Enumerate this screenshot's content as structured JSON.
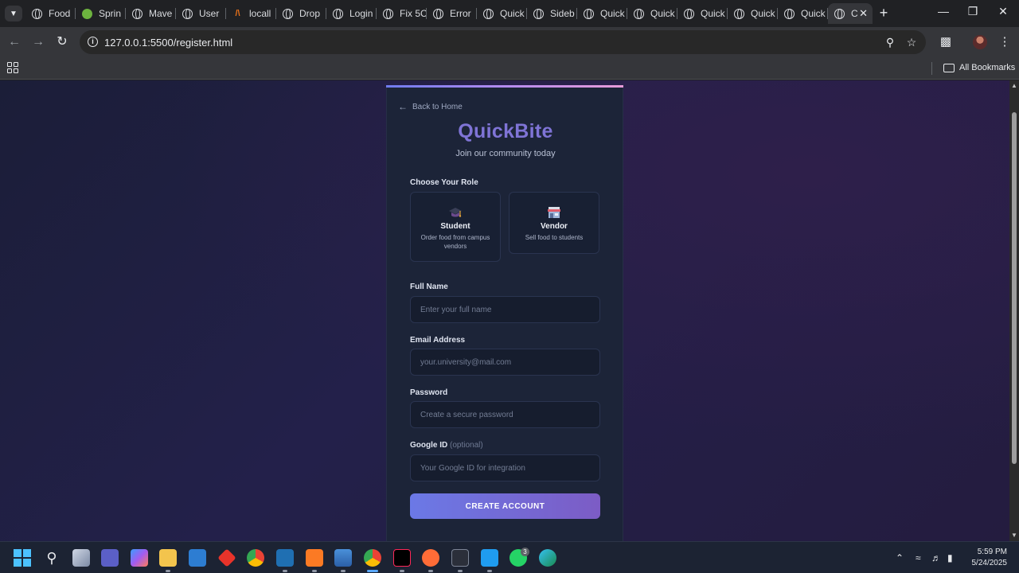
{
  "browser": {
    "tabs": [
      {
        "title": "Food",
        "icon": "globe"
      },
      {
        "title": "Sprin",
        "icon": "spring-leaf"
      },
      {
        "title": "Mave",
        "icon": "globe"
      },
      {
        "title": "User",
        "icon": "globe"
      },
      {
        "title": "locall",
        "icon": "maven"
      },
      {
        "title": "Drop",
        "icon": "globe"
      },
      {
        "title": "Login",
        "icon": "globe"
      },
      {
        "title": "Fix 5C",
        "icon": "globe"
      },
      {
        "title": "Error",
        "icon": "globe-outline"
      },
      {
        "title": "Quick",
        "icon": "globe-outline"
      },
      {
        "title": "Sideb",
        "icon": "globe"
      },
      {
        "title": "Quick",
        "icon": "globe-outline"
      },
      {
        "title": "Quick",
        "icon": "globe-outline"
      },
      {
        "title": "Quick",
        "icon": "globe-outline"
      },
      {
        "title": "Quick",
        "icon": "globe-outline"
      },
      {
        "title": "Quick",
        "icon": "globe-outline"
      }
    ],
    "active_tab": {
      "title": "C",
      "icon": "globe-outline"
    },
    "url": "127.0.0.1:5500/register.html",
    "bookmarks_label": "All Bookmarks"
  },
  "page": {
    "back_link": "Back to Home",
    "brand": "QuickBite",
    "tagline": "Join our community today",
    "role_section_label": "Choose Your Role",
    "roles": [
      {
        "title": "Student",
        "description": "Order food from campus vendors",
        "icon": "graduation-cap-icon"
      },
      {
        "title": "Vendor",
        "description": "Sell food to students",
        "icon": "store-icon"
      }
    ],
    "fields": {
      "full_name": {
        "label": "Full Name",
        "placeholder": "Enter your full name"
      },
      "email": {
        "label": "Email Address",
        "placeholder": "your.university@mail.com"
      },
      "password": {
        "label": "Password",
        "placeholder": "Create a secure password"
      },
      "google_id": {
        "label": "Google ID",
        "optional": "(optional)",
        "placeholder": "Your Google ID for integration"
      }
    },
    "submit_label": "CREATE ACCOUNT"
  },
  "taskbar": {
    "time": "5:59 PM",
    "date": "5/24/2025",
    "whatsapp_badge": "3"
  },
  "colors": {
    "brand": "#7f74d6",
    "button_start": "#6b79e6",
    "button_end": "#7c5cc5",
    "card_bg": "#1c2438"
  }
}
